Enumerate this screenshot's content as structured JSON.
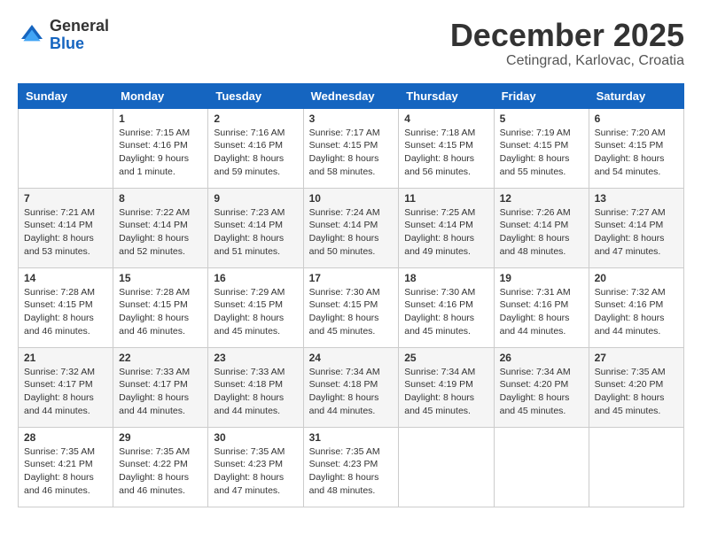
{
  "logo": {
    "general": "General",
    "blue": "Blue"
  },
  "header": {
    "month": "December 2025",
    "location": "Cetingrad, Karlovac, Croatia"
  },
  "weekdays": [
    "Sunday",
    "Monday",
    "Tuesday",
    "Wednesday",
    "Thursday",
    "Friday",
    "Saturday"
  ],
  "weeks": [
    [
      {
        "day": "",
        "content": ""
      },
      {
        "day": "1",
        "content": "Sunrise: 7:15 AM\nSunset: 4:16 PM\nDaylight: 9 hours\nand 1 minute."
      },
      {
        "day": "2",
        "content": "Sunrise: 7:16 AM\nSunset: 4:16 PM\nDaylight: 8 hours\nand 59 minutes."
      },
      {
        "day": "3",
        "content": "Sunrise: 7:17 AM\nSunset: 4:15 PM\nDaylight: 8 hours\nand 58 minutes."
      },
      {
        "day": "4",
        "content": "Sunrise: 7:18 AM\nSunset: 4:15 PM\nDaylight: 8 hours\nand 56 minutes."
      },
      {
        "day": "5",
        "content": "Sunrise: 7:19 AM\nSunset: 4:15 PM\nDaylight: 8 hours\nand 55 minutes."
      },
      {
        "day": "6",
        "content": "Sunrise: 7:20 AM\nSunset: 4:15 PM\nDaylight: 8 hours\nand 54 minutes."
      }
    ],
    [
      {
        "day": "7",
        "content": "Sunrise: 7:21 AM\nSunset: 4:14 PM\nDaylight: 8 hours\nand 53 minutes."
      },
      {
        "day": "8",
        "content": "Sunrise: 7:22 AM\nSunset: 4:14 PM\nDaylight: 8 hours\nand 52 minutes."
      },
      {
        "day": "9",
        "content": "Sunrise: 7:23 AM\nSunset: 4:14 PM\nDaylight: 8 hours\nand 51 minutes."
      },
      {
        "day": "10",
        "content": "Sunrise: 7:24 AM\nSunset: 4:14 PM\nDaylight: 8 hours\nand 50 minutes."
      },
      {
        "day": "11",
        "content": "Sunrise: 7:25 AM\nSunset: 4:14 PM\nDaylight: 8 hours\nand 49 minutes."
      },
      {
        "day": "12",
        "content": "Sunrise: 7:26 AM\nSunset: 4:14 PM\nDaylight: 8 hours\nand 48 minutes."
      },
      {
        "day": "13",
        "content": "Sunrise: 7:27 AM\nSunset: 4:14 PM\nDaylight: 8 hours\nand 47 minutes."
      }
    ],
    [
      {
        "day": "14",
        "content": "Sunrise: 7:28 AM\nSunset: 4:15 PM\nDaylight: 8 hours\nand 46 minutes."
      },
      {
        "day": "15",
        "content": "Sunrise: 7:28 AM\nSunset: 4:15 PM\nDaylight: 8 hours\nand 46 minutes."
      },
      {
        "day": "16",
        "content": "Sunrise: 7:29 AM\nSunset: 4:15 PM\nDaylight: 8 hours\nand 45 minutes."
      },
      {
        "day": "17",
        "content": "Sunrise: 7:30 AM\nSunset: 4:15 PM\nDaylight: 8 hours\nand 45 minutes."
      },
      {
        "day": "18",
        "content": "Sunrise: 7:30 AM\nSunset: 4:16 PM\nDaylight: 8 hours\nand 45 minutes."
      },
      {
        "day": "19",
        "content": "Sunrise: 7:31 AM\nSunset: 4:16 PM\nDaylight: 8 hours\nand 44 minutes."
      },
      {
        "day": "20",
        "content": "Sunrise: 7:32 AM\nSunset: 4:16 PM\nDaylight: 8 hours\nand 44 minutes."
      }
    ],
    [
      {
        "day": "21",
        "content": "Sunrise: 7:32 AM\nSunset: 4:17 PM\nDaylight: 8 hours\nand 44 minutes."
      },
      {
        "day": "22",
        "content": "Sunrise: 7:33 AM\nSunset: 4:17 PM\nDaylight: 8 hours\nand 44 minutes."
      },
      {
        "day": "23",
        "content": "Sunrise: 7:33 AM\nSunset: 4:18 PM\nDaylight: 8 hours\nand 44 minutes."
      },
      {
        "day": "24",
        "content": "Sunrise: 7:34 AM\nSunset: 4:18 PM\nDaylight: 8 hours\nand 44 minutes."
      },
      {
        "day": "25",
        "content": "Sunrise: 7:34 AM\nSunset: 4:19 PM\nDaylight: 8 hours\nand 45 minutes."
      },
      {
        "day": "26",
        "content": "Sunrise: 7:34 AM\nSunset: 4:20 PM\nDaylight: 8 hours\nand 45 minutes."
      },
      {
        "day": "27",
        "content": "Sunrise: 7:35 AM\nSunset: 4:20 PM\nDaylight: 8 hours\nand 45 minutes."
      }
    ],
    [
      {
        "day": "28",
        "content": "Sunrise: 7:35 AM\nSunset: 4:21 PM\nDaylight: 8 hours\nand 46 minutes."
      },
      {
        "day": "29",
        "content": "Sunrise: 7:35 AM\nSunset: 4:22 PM\nDaylight: 8 hours\nand 46 minutes."
      },
      {
        "day": "30",
        "content": "Sunrise: 7:35 AM\nSunset: 4:23 PM\nDaylight: 8 hours\nand 47 minutes."
      },
      {
        "day": "31",
        "content": "Sunrise: 7:35 AM\nSunset: 4:23 PM\nDaylight: 8 hours\nand 48 minutes."
      },
      {
        "day": "",
        "content": ""
      },
      {
        "day": "",
        "content": ""
      },
      {
        "day": "",
        "content": ""
      }
    ]
  ]
}
